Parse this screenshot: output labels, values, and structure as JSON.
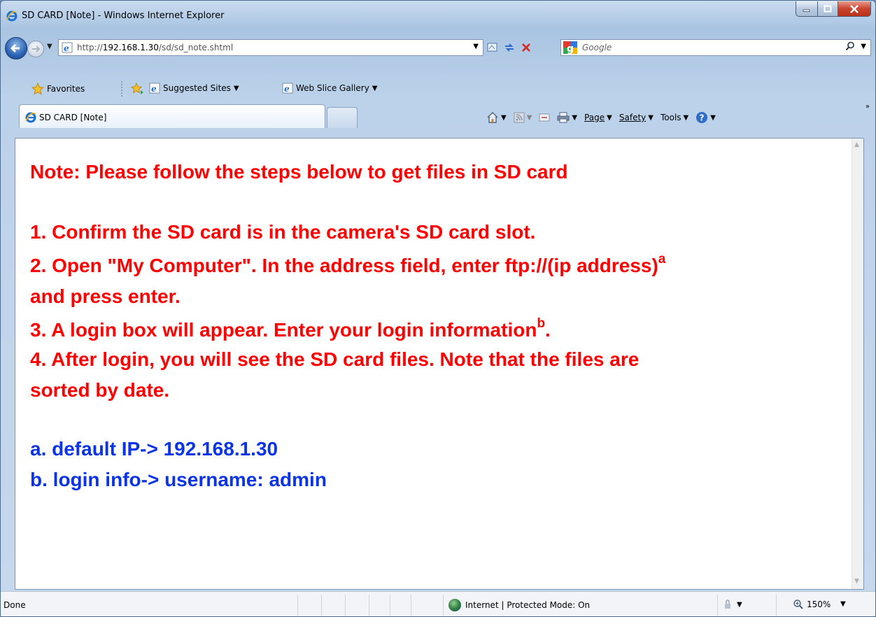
{
  "window": {
    "title": "SD CARD [Note] - Windows Internet Explorer"
  },
  "address_bar": {
    "url_prefix": "http://",
    "url_host": "192.168.1.30",
    "url_path": "/sd/sd_note.shtml",
    "search_placeholder": "Google"
  },
  "favorites_bar": {
    "favorites_label": "Favorites",
    "suggested_sites_label": "Suggested Sites",
    "web_slice_gallery_label": "Web Slice Gallery"
  },
  "tabs": [
    {
      "label": "SD CARD [Note]"
    }
  ],
  "command_bar": {
    "page_label": "Page",
    "safety_label": "Safety",
    "tools_label": "Tools"
  },
  "content": {
    "heading": "Note: Please follow the steps below to get files in SD card",
    "steps": [
      {
        "text": "1. Confirm the SD card is in the camera's SD card slot.",
        "sup": ""
      },
      {
        "text": "2. Open \"My Computer\". In the address field, enter ftp://(ip address)",
        "sup": "a"
      },
      {
        "text": "and press enter.",
        "sup": ""
      },
      {
        "text": "3. A login box will appear. Enter your login information",
        "sup": "b",
        "tail": "."
      },
      {
        "text": "4. After login, you will see the SD card files. Note that the files are",
        "sup": ""
      },
      {
        "text": "sorted by date.",
        "sup": ""
      }
    ],
    "footnotes": [
      "a. default IP-> 192.168.1.30",
      "b. login info-> username: admin"
    ],
    "colors": {
      "steps": "#ff0000",
      "footnotes": "#0a34e6"
    }
  },
  "status_bar": {
    "status_text": "Done",
    "zone_text": "Internet | Protected Mode: On",
    "zoom_text": "150%"
  }
}
